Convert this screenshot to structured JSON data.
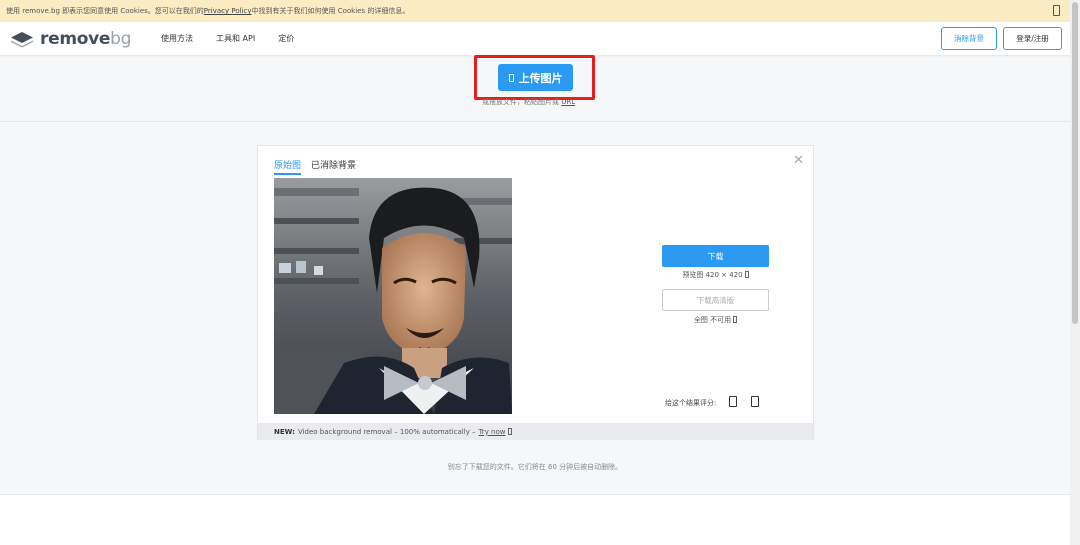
{
  "cookie": {
    "text_before": "使用 remove.bg 即表示您同意使用 Cookies。您可以在我们的",
    "link": "Privacy Policy",
    "text_after": "中找到有关于我们如何使用 Cookies 的详细信息。"
  },
  "header": {
    "logo_text_main": "remove",
    "logo_text_suffix": "bg",
    "nav": [
      "使用方法",
      "工具和 API",
      "定价"
    ],
    "remove_bg_label": "消除背景",
    "login_label": "登录/注册"
  },
  "upload": {
    "button_label": "上传图片",
    "hint_text": "或拖放文件，粘贴图片或",
    "hint_link": "URL"
  },
  "result": {
    "tab_original": "原始图",
    "tab_removed": "已消除背景",
    "close_symbol": "✕",
    "download_label": "下载",
    "preview_info": "预览图 420 × 420",
    "download_hd_label": "下载高清版",
    "full_info": "全图 不可用",
    "rate_label": "给这个结果评分:",
    "promo_bold": "NEW:",
    "promo_text": "Video background removal – 100% automatically –",
    "promo_link": "Try now"
  },
  "footnote": "别忘了下载您的文件。它们将在 60 分钟后被自动删除。",
  "colors": {
    "accent": "#2b9af3",
    "highlight": "#e61e1e",
    "cookie_bg": "#fbecc4"
  },
  "icons": [
    "cookie-close-icon",
    "logo-icon",
    "upload-icon",
    "close-icon",
    "thumbs-up-icon",
    "thumbs-down-icon",
    "info-icon"
  ]
}
